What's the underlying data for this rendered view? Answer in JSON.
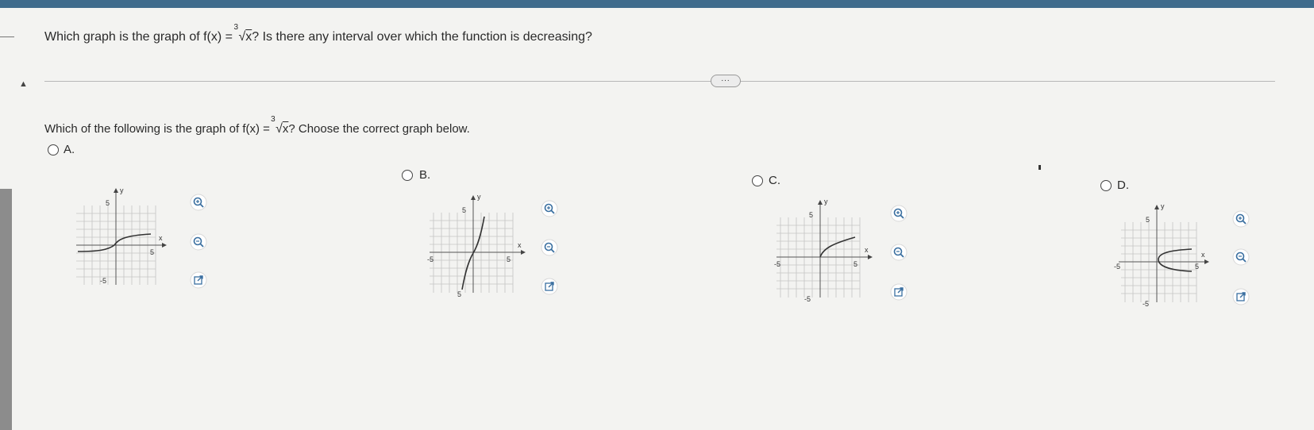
{
  "question": {
    "text_before": "Which graph is the graph of ",
    "formula_lhs": "f(x) = ",
    "root_index": "3",
    "radicand": "x",
    "text_after": "? Is there any interval over which the function is decreasing?"
  },
  "more_button": {
    "label": "..."
  },
  "prompt": {
    "text_before": "Which of the following is the graph of ",
    "formula_lhs": "f(x) = ",
    "root_index": "3",
    "radicand": "x",
    "text_after": "? Choose the correct graph below."
  },
  "options": [
    {
      "label": "A.",
      "axis_y": "y",
      "axis_x": "x",
      "tick_top": "5",
      "tick_bottom": "-5",
      "tick_right": "5",
      "tick_left": ""
    },
    {
      "label": "B.",
      "axis_y": "y",
      "axis_x": "x",
      "tick_top": "5",
      "tick_bottom": "5",
      "tick_right": "5",
      "tick_left": "-5"
    },
    {
      "label": "C.",
      "axis_y": "y",
      "axis_x": "x",
      "tick_top": "5",
      "tick_bottom": "-5",
      "tick_right": "5",
      "tick_left": "-5"
    },
    {
      "label": "D.",
      "axis_y": "y",
      "axis_x": "x",
      "tick_top": "5",
      "tick_bottom": "-5",
      "tick_right": "5",
      "tick_left": "-5"
    }
  ],
  "icons": {
    "zoom_in": "zoom-in-icon",
    "zoom_out": "zoom-out-icon",
    "open": "open-in-new-window-icon"
  }
}
